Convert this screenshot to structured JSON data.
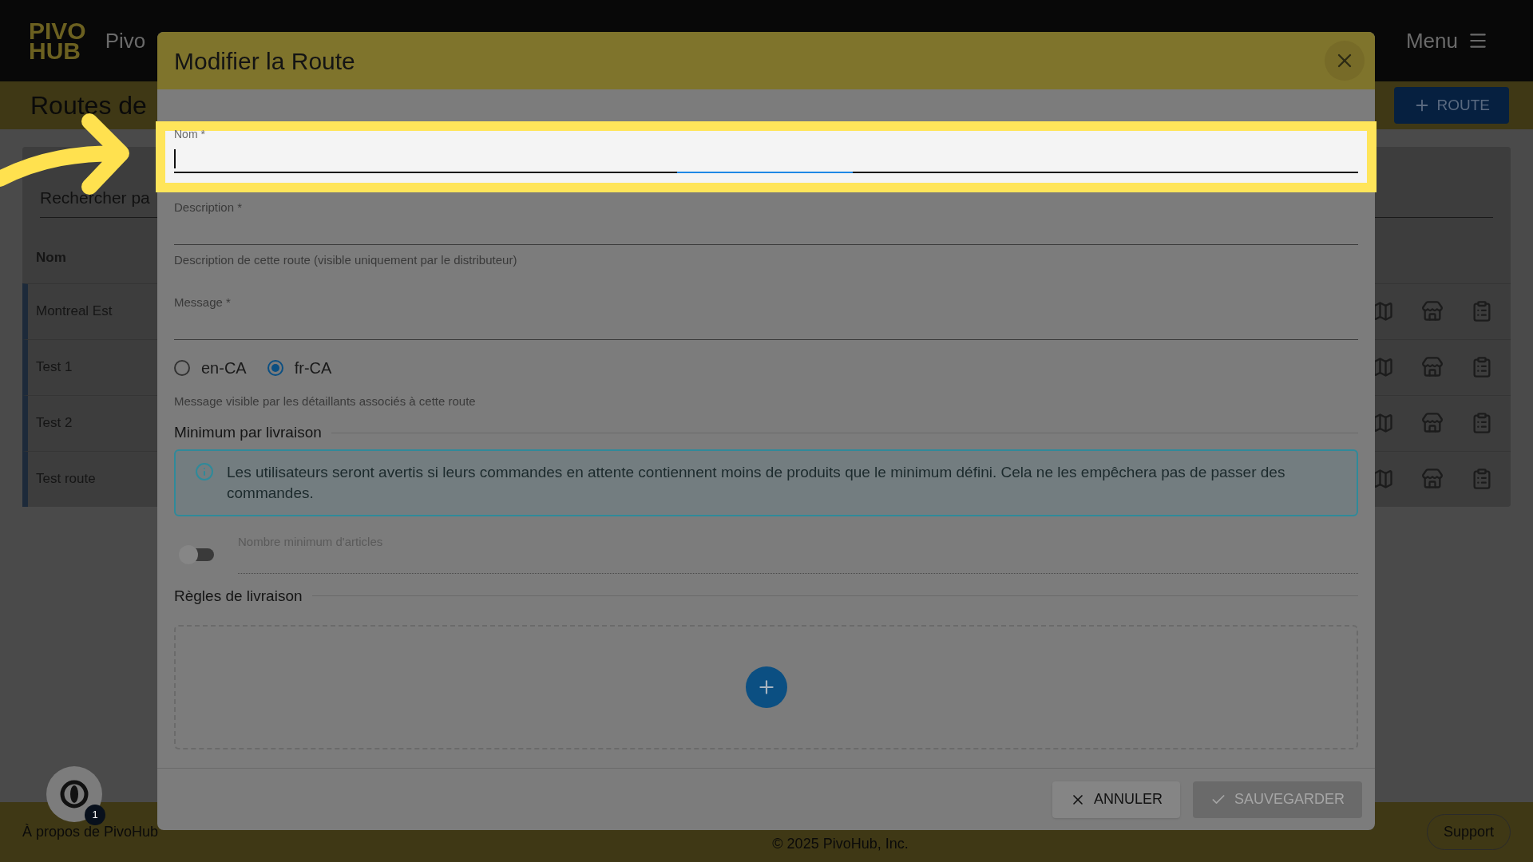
{
  "app_bar": {
    "logo_top": "PIVO",
    "logo_bottom": "HUB",
    "brand": "Pivo",
    "menu": "Menu"
  },
  "page": {
    "title": "Routes de",
    "add_button": "ROUTE",
    "search": {
      "placeholder": "Rechercher pa"
    },
    "columns": [
      "Nom"
    ],
    "rows": [
      {
        "name": "Montreal Est"
      },
      {
        "name": "Test 1"
      },
      {
        "name": "Test 2"
      },
      {
        "name": "Test route"
      }
    ]
  },
  "footer": {
    "about": "À propos de PivoHub",
    "copyright": "© 2025 PivoHub, Inc.",
    "support": "Support"
  },
  "chat_badge": "1",
  "dialog": {
    "title": "Modifier la Route",
    "fields": [
      {
        "label": "Nom *",
        "focused": true
      },
      {
        "label": "Description *",
        "focused": false,
        "helper": "Description de cette route (visible uniquement par le distributeur)"
      },
      {
        "label": "Message *",
        "focused": false
      }
    ],
    "languages": [
      {
        "label": "en-CA",
        "selected": false
      },
      {
        "label": "fr-CA",
        "selected": true
      }
    ],
    "message_helper": "Message visible par les détaillants associés à cette route",
    "minimum_section": "Minimum par livraison",
    "info": "Les utilisateurs seront avertis si leurs commandes en attente contiennent moins de produits que le minimum défini. Cela ne les empêchera pas de passer des commandes.",
    "minimum_toggle": {
      "label": "Nombre minimum d'articles",
      "on": false
    },
    "rules_section": "Règles de livraison",
    "cancel": "ANNULER",
    "save": {
      "label": "SAUVEGARDER",
      "disabled": true
    }
  }
}
